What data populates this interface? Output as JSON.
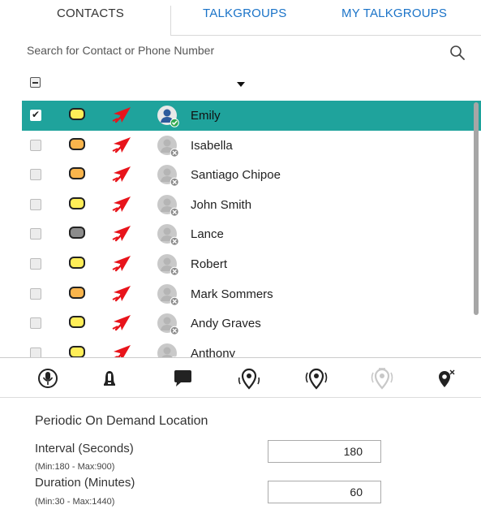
{
  "tabs": [
    {
      "label": "CONTACTS",
      "active": true
    },
    {
      "label": "TALKGROUPS",
      "active": false
    },
    {
      "label": "MY TALKGROUPS",
      "active": false
    }
  ],
  "search": {
    "placeholder": "Search for Contact or Phone Number",
    "icon": "search-icon"
  },
  "colors": {
    "selected_row": "#1fa39c",
    "link": "#1a73c8",
    "yellow": "#ffee58",
    "orange": "#f9b54c",
    "gray": "#8c8c8c",
    "red_arrow": "#e8141b"
  },
  "contacts": [
    {
      "name": "Emily",
      "status_color": "yellow",
      "selected": true,
      "online": true
    },
    {
      "name": "Isabella",
      "status_color": "orange",
      "selected": false,
      "online": false
    },
    {
      "name": "Santiago Chipoe",
      "status_color": "orange",
      "selected": false,
      "online": false
    },
    {
      "name": "John Smith",
      "status_color": "yellow",
      "selected": false,
      "online": false
    },
    {
      "name": "Lance",
      "status_color": "gray",
      "selected": false,
      "online": false
    },
    {
      "name": "Robert",
      "status_color": "yellow",
      "selected": false,
      "online": false
    },
    {
      "name": "Mark Sommers",
      "status_color": "orange",
      "selected": false,
      "online": false
    },
    {
      "name": "Andy Graves",
      "status_color": "yellow",
      "selected": false,
      "online": false
    },
    {
      "name": "Anthony",
      "status_color": "yellow",
      "selected": false,
      "online": false
    }
  ],
  "actions": [
    {
      "name": "mic-icon",
      "enabled": true
    },
    {
      "name": "alert-bell-icon",
      "enabled": true
    },
    {
      "name": "message-icon",
      "enabled": true
    },
    {
      "name": "location-icon",
      "enabled": true
    },
    {
      "name": "location-target-icon",
      "enabled": true
    },
    {
      "name": "location-periodic-icon",
      "enabled": false
    },
    {
      "name": "location-cancel-icon",
      "enabled": true
    }
  ],
  "periodic": {
    "title": "Periodic On Demand Location",
    "interval_label": "Interval (Seconds)",
    "interval_hint": "(Min:180 - Max:900)",
    "interval_value": "180",
    "duration_label": "Duration (Minutes)",
    "duration_hint": "(Min:30 - Max:1440)",
    "duration_value": "60"
  }
}
